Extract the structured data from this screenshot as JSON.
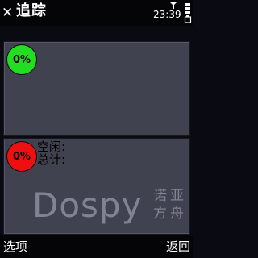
{
  "header": {
    "title": "追踪",
    "close_icon": "close-icon",
    "time": "23:39",
    "signal_icon": "signal-icon",
    "battery_icon": "battery-icon"
  },
  "panels": [
    {
      "gauge": {
        "text": "0%",
        "color": "#22dd22",
        "value": 0
      }
    },
    {
      "gauge": {
        "text": "0%",
        "color": "#ee1010",
        "value": 0
      },
      "stats": {
        "idle_label": "空闲:",
        "total_label": "总计:"
      }
    }
  ],
  "watermark": {
    "latin": "Dospy",
    "cjk": "诺亚方舟"
  },
  "softkeys": {
    "left": "选项",
    "right": "返回"
  },
  "colors": {
    "panel": "#414250",
    "background": "#0a0a12"
  }
}
